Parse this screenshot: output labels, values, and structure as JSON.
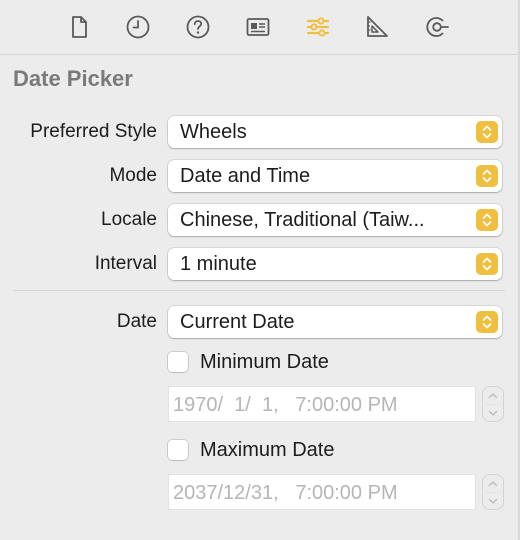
{
  "toolbar": {
    "icons": [
      "file-icon",
      "clock-icon",
      "help-icon",
      "inspector-icon",
      "attributes-icon",
      "ruler-icon",
      "connections-icon"
    ],
    "active": "attributes-icon",
    "accent": "#f1bf40"
  },
  "section": {
    "title": "Date Picker"
  },
  "fields": {
    "preferred_style": {
      "label": "Preferred Style",
      "value": "Wheels"
    },
    "mode": {
      "label": "Mode",
      "value": "Date and Time"
    },
    "locale": {
      "label": "Locale",
      "value": "Chinese, Traditional (Taiw..."
    },
    "interval": {
      "label": "Interval",
      "value": "1 minute"
    },
    "date": {
      "label": "Date",
      "value": "Current Date"
    }
  },
  "minimum_date": {
    "checkbox_label": "Minimum Date",
    "checked": false,
    "value": "1970/  1/  1,   7:00:00 PM"
  },
  "maximum_date": {
    "checkbox_label": "Maximum Date",
    "checked": false,
    "value": "2037/12/31,   7:00:00 PM"
  }
}
